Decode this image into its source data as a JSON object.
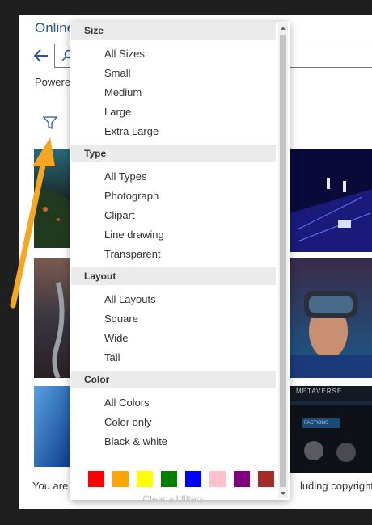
{
  "panel": {
    "title": "Online",
    "powered_by": "Powere",
    "footer_left": "You are",
    "footer_right": "luding copyright"
  },
  "filter_menu": {
    "sections": [
      {
        "header": "Size",
        "items": [
          "All Sizes",
          "Small",
          "Medium",
          "Large",
          "Extra Large"
        ]
      },
      {
        "header": "Type",
        "items": [
          "All Types",
          "Photograph",
          "Clipart",
          "Line drawing",
          "Transparent"
        ]
      },
      {
        "header": "Layout",
        "items": [
          "All Layouts",
          "Square",
          "Wide",
          "Tall"
        ]
      },
      {
        "header": "Color",
        "items": [
          "All Colors",
          "Color only",
          "Black & white"
        ]
      }
    ],
    "color_swatches": [
      "#ff0000",
      "#ffa500",
      "#ffff00",
      "#008000",
      "#0000ff",
      "#ffc0cb",
      "#800080",
      "#a52a2a"
    ],
    "clear_label": "Clear all filters"
  },
  "thumbnails": {
    "tile_banner_text": "METAVERSE",
    "tile_button_text": "FACTIONS"
  },
  "colors": {
    "title_blue": "#2b5797",
    "annotation_arrow": "#f5a623"
  },
  "icons": {
    "back": "back-arrow-icon",
    "search": "search-icon",
    "filter": "filter-icon"
  }
}
